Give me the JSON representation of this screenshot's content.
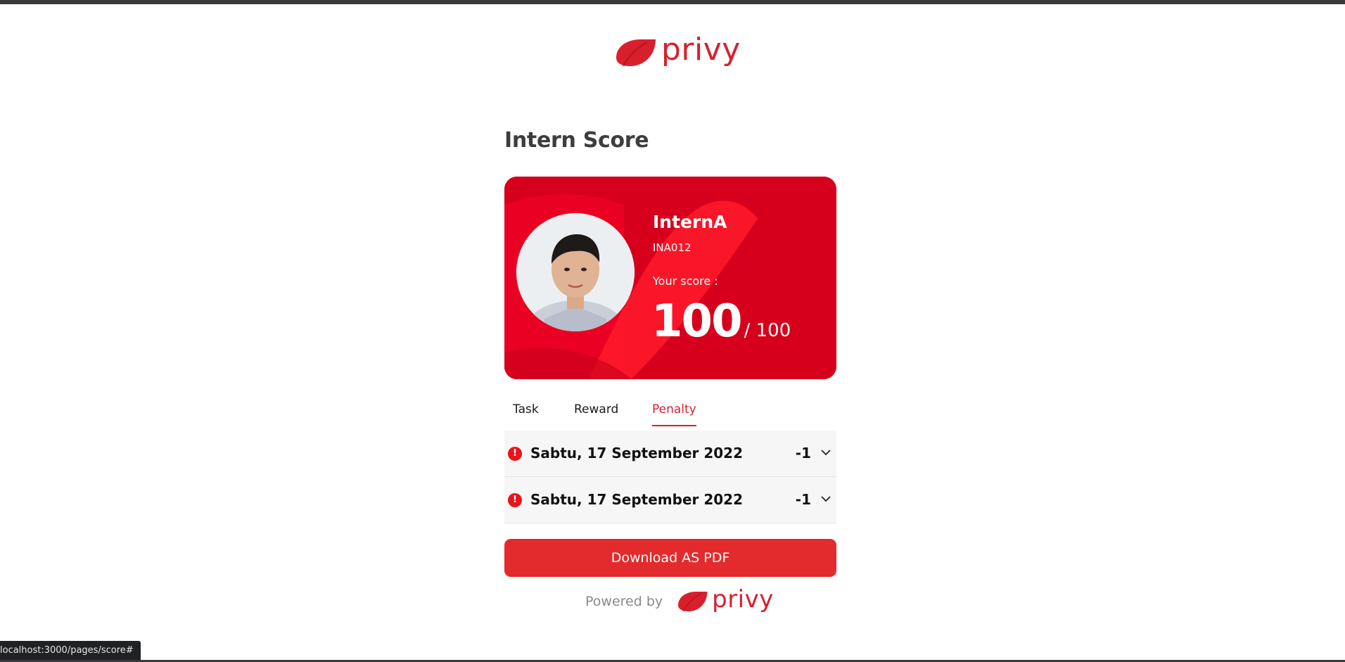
{
  "header": {
    "logo_text": "privy"
  },
  "page_title": "Intern Score",
  "profile": {
    "name": "InternA",
    "id": "INA012",
    "score_label": "Your score :",
    "score": "100",
    "score_max": "/ 100"
  },
  "tabs": [
    {
      "label": "Task",
      "active": false
    },
    {
      "label": "Reward",
      "active": false
    },
    {
      "label": "Penalty",
      "active": true
    }
  ],
  "penalties": [
    {
      "date": "Sabtu, 17 September 2022",
      "points": "-1",
      "icon": "alert-icon"
    },
    {
      "date": "Sabtu, 17 September 2022",
      "points": "-1",
      "icon": "alert-icon"
    }
  ],
  "download_button": {
    "label": "Download AS PDF"
  },
  "footer": {
    "powered_by": "Powered by",
    "logo_text": "privy"
  },
  "status_bar": {
    "url": "localhost:3000/pages/score#"
  },
  "colors": {
    "brand": "#d8202d",
    "card": "#d6001c",
    "button": "#e32b2d",
    "alert": "#e8141b"
  }
}
